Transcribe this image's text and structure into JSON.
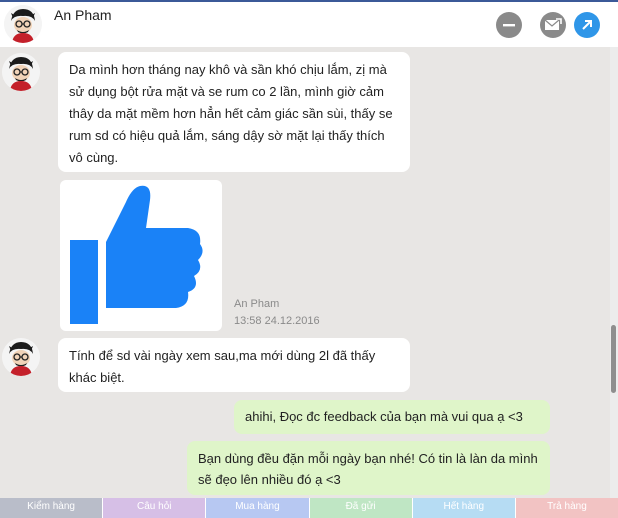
{
  "header": {
    "contact_name": "An Pham"
  },
  "messages": [
    {
      "direction": "in",
      "text": "Da mình hơn tháng nay khô và sần khó chịu lắm, zị mà sử dụng bột rửa mặt và se rum co 2 lần, mình giờ cảm thây da mặt mềm hơn hẳn hết cảm giác sần sùi, thấy se rum sd có hiệu quả lắm, sáng dậy sờ mặt lại thấy thích vô cùng."
    },
    {
      "direction": "in",
      "type": "like-sticker",
      "sender": "An Pham",
      "time": "13:58 24.12.2016"
    },
    {
      "direction": "in",
      "text": "Tính để sd vài ngày xem sau,ma mới dùng 2l đã thấy khác biệt."
    },
    {
      "direction": "out",
      "text": "ahihi, Đọc đc feedback của bạn mà vui qua ạ <3"
    },
    {
      "direction": "out",
      "text": "Bạn dùng đều đặn mỗi ngày bạn nhé! Có tin là làn da mình sẽ đẹo lên nhiều đó ạ <3"
    }
  ],
  "tabs": [
    {
      "label": "Kiểm hàng",
      "color": "#b9bdc9"
    },
    {
      "label": "Câu hỏi",
      "color": "#d6bfe6"
    },
    {
      "label": "Mua hàng",
      "color": "#b7c8f2"
    },
    {
      "label": "Đã gửi",
      "color": "#bfe6c4"
    },
    {
      "label": "Hết hàng",
      "color": "#b6dcf3"
    },
    {
      "label": "Trả hàng",
      "color": "#f2c3c3"
    }
  ],
  "colors": {
    "incoming_bubble": "#ffffff",
    "outgoing_bubble": "#dff5c9",
    "chat_background": "#e8e6e4",
    "like_blue": "#1a82f7",
    "open_button": "#2f96e8"
  },
  "icons": [
    "minimize-icon",
    "mail-icon",
    "open-external-icon",
    "like-icon"
  ]
}
